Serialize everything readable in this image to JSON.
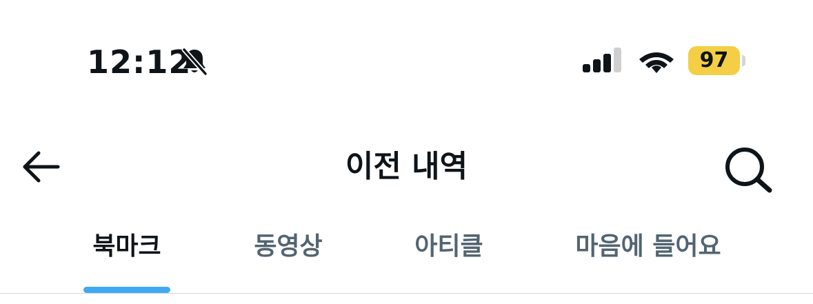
{
  "status_bar": {
    "time": "12:12",
    "battery_level": "97",
    "icons": [
      "bell-slash-icon",
      "cellular-signal-icon",
      "wifi-icon",
      "battery-icon"
    ],
    "battery_color": "#f4cf45"
  },
  "header": {
    "title": "이전 내역",
    "icons": [
      "arrow-left-icon",
      "search-icon"
    ]
  },
  "tabs": [
    {
      "label": "북마크",
      "active": true
    },
    {
      "label": "동영상",
      "active": false
    },
    {
      "label": "아티클",
      "active": false
    },
    {
      "label": "마음에 들어요",
      "active": false
    }
  ],
  "colors": {
    "accent": "#1d9bf0",
    "text_primary": "#0f1419",
    "text_secondary": "#536471"
  }
}
